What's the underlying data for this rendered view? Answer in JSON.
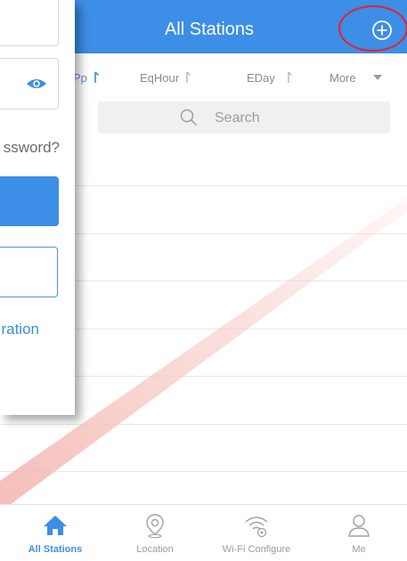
{
  "header": {
    "title": "All Stations"
  },
  "sort_bar": {
    "items": [
      {
        "label": "Pp"
      },
      {
        "label": "EqHour"
      },
      {
        "label": "EDay"
      },
      {
        "label": "More"
      }
    ]
  },
  "search": {
    "placeholder": "Search"
  },
  "login_screen": {
    "forgot_label": "ssword?",
    "registration_label": "ration"
  },
  "tabbar": {
    "items": [
      {
        "label": "All Stations",
        "icon": "home-icon",
        "active": true
      },
      {
        "label": "Location",
        "icon": "location-pin-icon",
        "active": false
      },
      {
        "label": "Wi-Fi Configure",
        "icon": "wifi-configure-icon",
        "active": false
      },
      {
        "label": "Me",
        "icon": "person-icon",
        "active": false
      }
    ]
  },
  "colors": {
    "header_blue": "#3c8ee6",
    "highlight_red": "#e8212e",
    "active_tab": "#3c8ee6",
    "inactive_text": "#9b9b9b"
  }
}
